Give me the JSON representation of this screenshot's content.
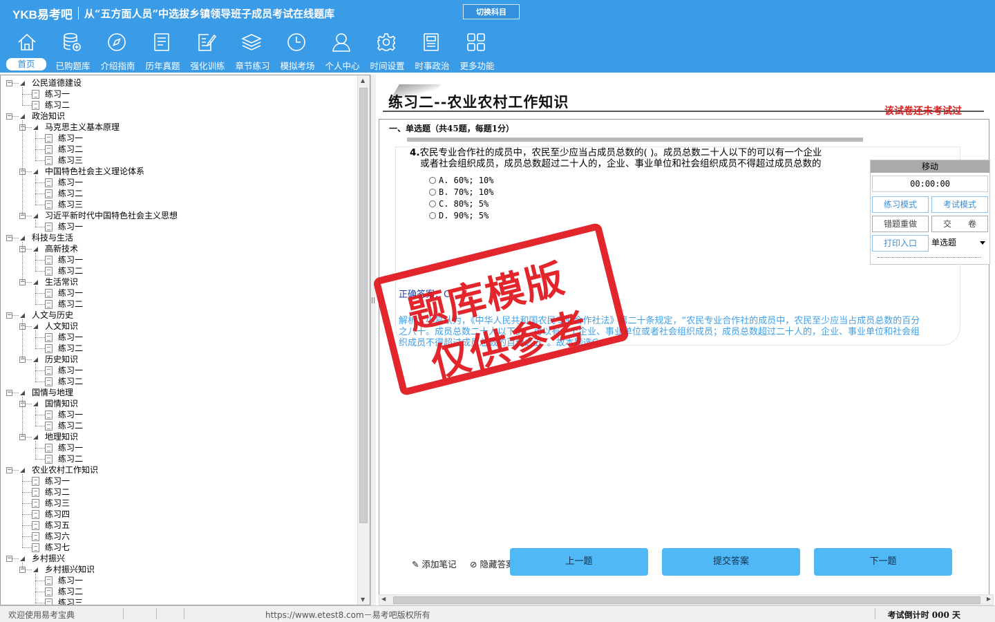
{
  "header": {
    "logo": "YKB易考吧",
    "title": "从“五方面人员”中选拔乡镇领导班子成员考试在线题库",
    "switch_subject": "切换科目",
    "tools": [
      {
        "label": "首页",
        "icon": "home-icon",
        "active": true
      },
      {
        "label": "已购题库",
        "icon": "database-add-icon"
      },
      {
        "label": "介绍指南",
        "icon": "compass-icon"
      },
      {
        "label": "历年真题",
        "icon": "list-document-icon"
      },
      {
        "label": "强化训练",
        "icon": "edit-document-icon"
      },
      {
        "label": "章节练习",
        "icon": "layers-icon"
      },
      {
        "label": "模拟考场",
        "icon": "clock-icon"
      },
      {
        "label": "个人中心",
        "icon": "user-icon"
      },
      {
        "label": "时间设置",
        "icon": "gear-icon"
      },
      {
        "label": "时事政治",
        "icon": "newspaper-icon"
      },
      {
        "label": "更多功能",
        "icon": "grid-icon"
      }
    ]
  },
  "tree": [
    {
      "level": 0,
      "label": "公民道德建设",
      "type": "folder"
    },
    {
      "level": 1,
      "label": "练习一",
      "type": "doc"
    },
    {
      "level": 1,
      "label": "练习二",
      "type": "doc"
    },
    {
      "level": 0,
      "label": "政治知识",
      "type": "folder"
    },
    {
      "level": 1,
      "label": "马克思主义基本原理",
      "type": "folder"
    },
    {
      "level": 2,
      "label": "练习一",
      "type": "doc"
    },
    {
      "level": 2,
      "label": "练习二",
      "type": "doc"
    },
    {
      "level": 2,
      "label": "练习三",
      "type": "doc"
    },
    {
      "level": 1,
      "label": "中国特色社会主义理论体系",
      "type": "folder"
    },
    {
      "level": 2,
      "label": "练习一",
      "type": "doc"
    },
    {
      "level": 2,
      "label": "练习二",
      "type": "doc"
    },
    {
      "level": 2,
      "label": "练习三",
      "type": "doc"
    },
    {
      "level": 1,
      "label": "习近平新时代中国特色社会主义思想",
      "type": "folder"
    },
    {
      "level": 2,
      "label": "练习一",
      "type": "doc"
    },
    {
      "level": 0,
      "label": "科技与生活",
      "type": "folder"
    },
    {
      "level": 1,
      "label": "高新技术",
      "type": "folder"
    },
    {
      "level": 2,
      "label": "练习一",
      "type": "doc"
    },
    {
      "level": 2,
      "label": "练习二",
      "type": "doc"
    },
    {
      "level": 1,
      "label": "生活常识",
      "type": "folder"
    },
    {
      "level": 2,
      "label": "练习一",
      "type": "doc"
    },
    {
      "level": 2,
      "label": "练习二",
      "type": "doc"
    },
    {
      "level": 0,
      "label": "人文与历史",
      "type": "folder"
    },
    {
      "level": 1,
      "label": "人文知识",
      "type": "folder"
    },
    {
      "level": 2,
      "label": "练习一",
      "type": "doc"
    },
    {
      "level": 2,
      "label": "练习二",
      "type": "doc"
    },
    {
      "level": 1,
      "label": "历史知识",
      "type": "folder"
    },
    {
      "level": 2,
      "label": "练习一",
      "type": "doc"
    },
    {
      "level": 2,
      "label": "练习二",
      "type": "doc"
    },
    {
      "level": 0,
      "label": "国情与地理",
      "type": "folder"
    },
    {
      "level": 1,
      "label": "国情知识",
      "type": "folder"
    },
    {
      "level": 2,
      "label": "练习一",
      "type": "doc"
    },
    {
      "level": 2,
      "label": "练习二",
      "type": "doc"
    },
    {
      "level": 1,
      "label": "地理知识",
      "type": "folder"
    },
    {
      "level": 2,
      "label": "练习一",
      "type": "doc"
    },
    {
      "level": 2,
      "label": "练习二",
      "type": "doc"
    },
    {
      "level": 0,
      "label": "农业农村工作知识",
      "type": "folder"
    },
    {
      "level": 1,
      "label": "练习一",
      "type": "doc"
    },
    {
      "level": 1,
      "label": "练习二",
      "type": "doc"
    },
    {
      "level": 1,
      "label": "练习三",
      "type": "doc"
    },
    {
      "level": 1,
      "label": "练习四",
      "type": "doc"
    },
    {
      "level": 1,
      "label": "练习五",
      "type": "doc"
    },
    {
      "level": 1,
      "label": "练习六",
      "type": "doc"
    },
    {
      "level": 1,
      "label": "练习七",
      "type": "doc"
    },
    {
      "level": 0,
      "label": "乡村振兴",
      "type": "folder"
    },
    {
      "level": 1,
      "label": "乡村振兴知识",
      "type": "folder"
    },
    {
      "level": 2,
      "label": "练习一",
      "type": "doc"
    },
    {
      "level": 2,
      "label": "练习二",
      "type": "doc"
    },
    {
      "level": 2,
      "label": "练习三",
      "type": "doc"
    }
  ],
  "paper": {
    "title": "练习二--农业农村工作知识",
    "status": "该试卷还未考试过",
    "section": "一、单选题（共45题，每题1分）"
  },
  "question": {
    "number": "4.",
    "line1": "农民专业合作社的成员中，农民至少应当占成员总数的( )。成员总数二十人以下的可以有一个企业",
    "line2": "或者社会组织成员，成员总数超过二十人的，企业、事业单位和社会组织成员不得超过成员总数的",
    "options": [
      "A. 60%; 10%",
      "B. 70%; 10%",
      "C. 80%; 5%",
      "D. 90%; 5%"
    ],
    "answer": "正确答案：C",
    "analysis": "解析：小易认为，《中华人民共和国农民专业合作社法》第二十条规定，“农民专业合作社的成员中，农民至少应当占成员总数的百分之八十。成员总数二十人以下的，可以有一个企业、事业单位或者社会组织成员；成员总数超过二十人的，企业、事业单位和社会组织成员不得超过成员总数的百分之五”。故本题选C。"
  },
  "mini_panel": {
    "move": "移动",
    "timer": "00:00:00",
    "practice_mode": "练习模式",
    "exam_mode": "考试模式",
    "redo_wrong": "错题重做",
    "submit_paper": "交　　卷",
    "print": "打印入口",
    "question_type": "单选题"
  },
  "actions": {
    "add_note": "添加笔记",
    "hide_answer": "隐藏答案",
    "prev": "上一题",
    "submit": "提交答案",
    "next": "下一题"
  },
  "watermark": {
    "line1": "题库模版",
    "line2": "仅供参考"
  },
  "status_bar": {
    "welcome": "欢迎使用易考宝典",
    "copyright": "https://www.etest8.com－易考吧版权所有",
    "countdown": "考试倒计时 000 天"
  },
  "colors": {
    "header": "#3a9be6",
    "status_red": "#d62020",
    "analysis": "#3ea0e8",
    "answer": "#1a3ea8",
    "button": "#4fb8f5",
    "stamp": "#e0141a"
  }
}
